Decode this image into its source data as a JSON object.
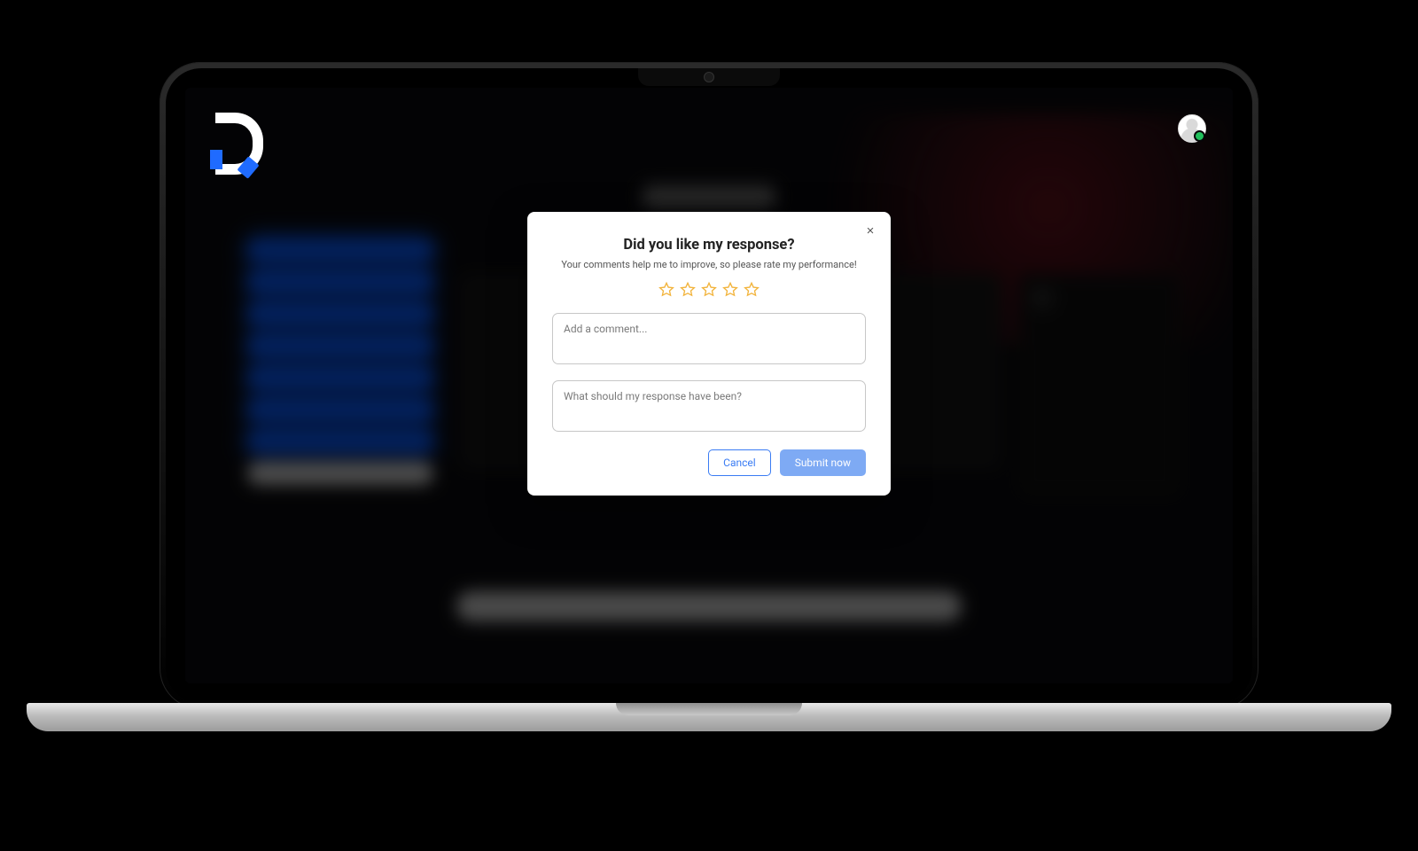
{
  "colors": {
    "accent": "#3a7cf4",
    "star": "#f2b33a",
    "presence": "#21c05c"
  },
  "header": {
    "logo_name": "app-logo",
    "avatar_presence": "online"
  },
  "backdrop": {
    "title_placeholder": "Ask a question",
    "sidebar_item_count": 7
  },
  "modal": {
    "title": "Did you like my response?",
    "subtitle": "Your comments help me to improve, so please rate my performance!",
    "close_glyph": "×",
    "star_rating": {
      "count": 5,
      "value": 0
    },
    "comment": {
      "placeholder": "Add a comment...",
      "value": ""
    },
    "suggested_response": {
      "placeholder": "What should my response have been?",
      "value": ""
    },
    "cancel_label": "Cancel",
    "submit_label": "Submit now"
  }
}
